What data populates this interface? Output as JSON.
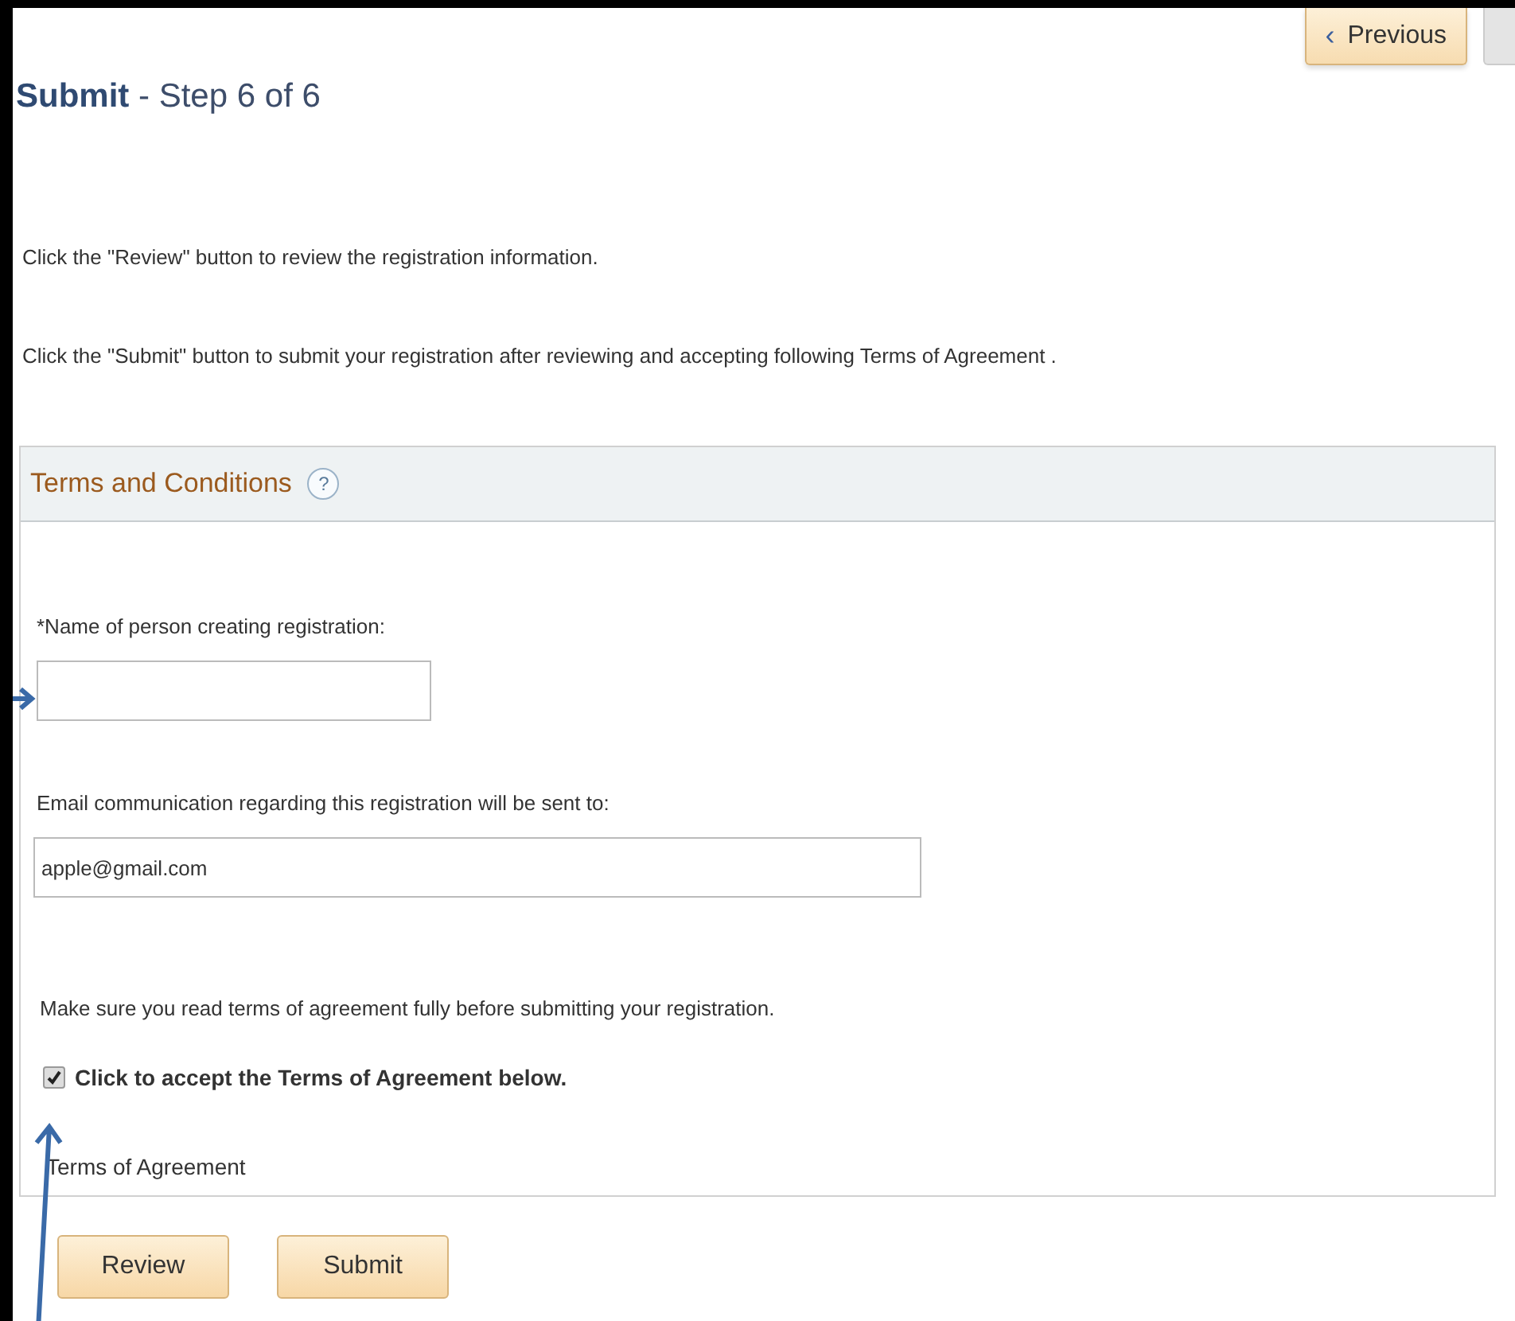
{
  "nav": {
    "previous": {
      "arrow": "‹",
      "label": "Previous"
    }
  },
  "heading": {
    "title": "Submit",
    "subtitle": "- Step 6 of 6"
  },
  "instructions": [
    "Click the \"Review\" button to review the registration information.",
    "Click the \"Submit\" button to submit your registration after reviewing and accepting following Terms of Agreement ."
  ],
  "section": {
    "title": "Terms and Conditions",
    "help": "?",
    "name_field": {
      "label": "*Name of person creating registration:"
    },
    "email_field": {
      "label": "Email communication regarding this registration will be sent to:",
      "value": "apple@gmail.com"
    },
    "notice": "Make sure you read terms of agreement fully before submitting your registration.",
    "accept": {
      "label": "Click to accept the Terms of Agreement below.",
      "checked": true
    },
    "terms_link": "Terms of Agreement"
  },
  "buttons": [
    "Review",
    "Submit"
  ]
}
